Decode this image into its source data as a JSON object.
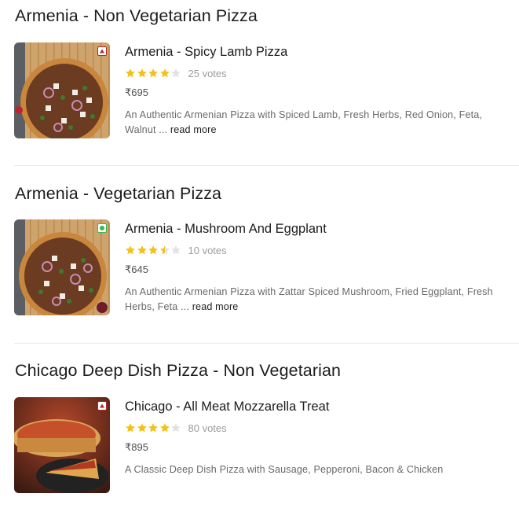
{
  "sections": [
    {
      "title": "Armenia - Non Vegetarian Pizza",
      "item": {
        "name": "Armenia - Spicy Lamb Pizza",
        "diet": "non-veg-mark-icon",
        "rating": 4,
        "votes": "25 votes",
        "price": "₹695",
        "description": "An Authentic Armenian Pizza with Spiced Lamb, Fresh Herbs, Red Onion, Feta, Walnut ...",
        "read_more": "read more"
      }
    },
    {
      "title": "Armenia - Vegetarian Pizza",
      "item": {
        "name": "Armenia - Mushroom And Eggplant",
        "diet": "veg-mark-icon",
        "rating": 3.5,
        "votes": "10 votes",
        "price": "₹645",
        "description": "An Authentic Armenian Pizza with Zattar Spiced Mushroom, Fried Eggplant, Fresh Herbs, Feta ...",
        "read_more": "read more"
      }
    },
    {
      "title": "Chicago Deep Dish Pizza - Non Vegetarian",
      "item": {
        "name": "Chicago - All Meat Mozzarella Treat",
        "diet": "non-veg-mark-icon",
        "rating": 4,
        "votes": "80 votes",
        "price": "₹895",
        "description": "A Classic Deep Dish Pizza with Sausage, Pepperoni, Bacon & Chicken",
        "read_more": ""
      }
    }
  ],
  "colors": {
    "star_filled": "#f3c117",
    "star_empty": "#e2e2e2",
    "non_veg": "#b02a2a",
    "veg": "#3ab757"
  }
}
